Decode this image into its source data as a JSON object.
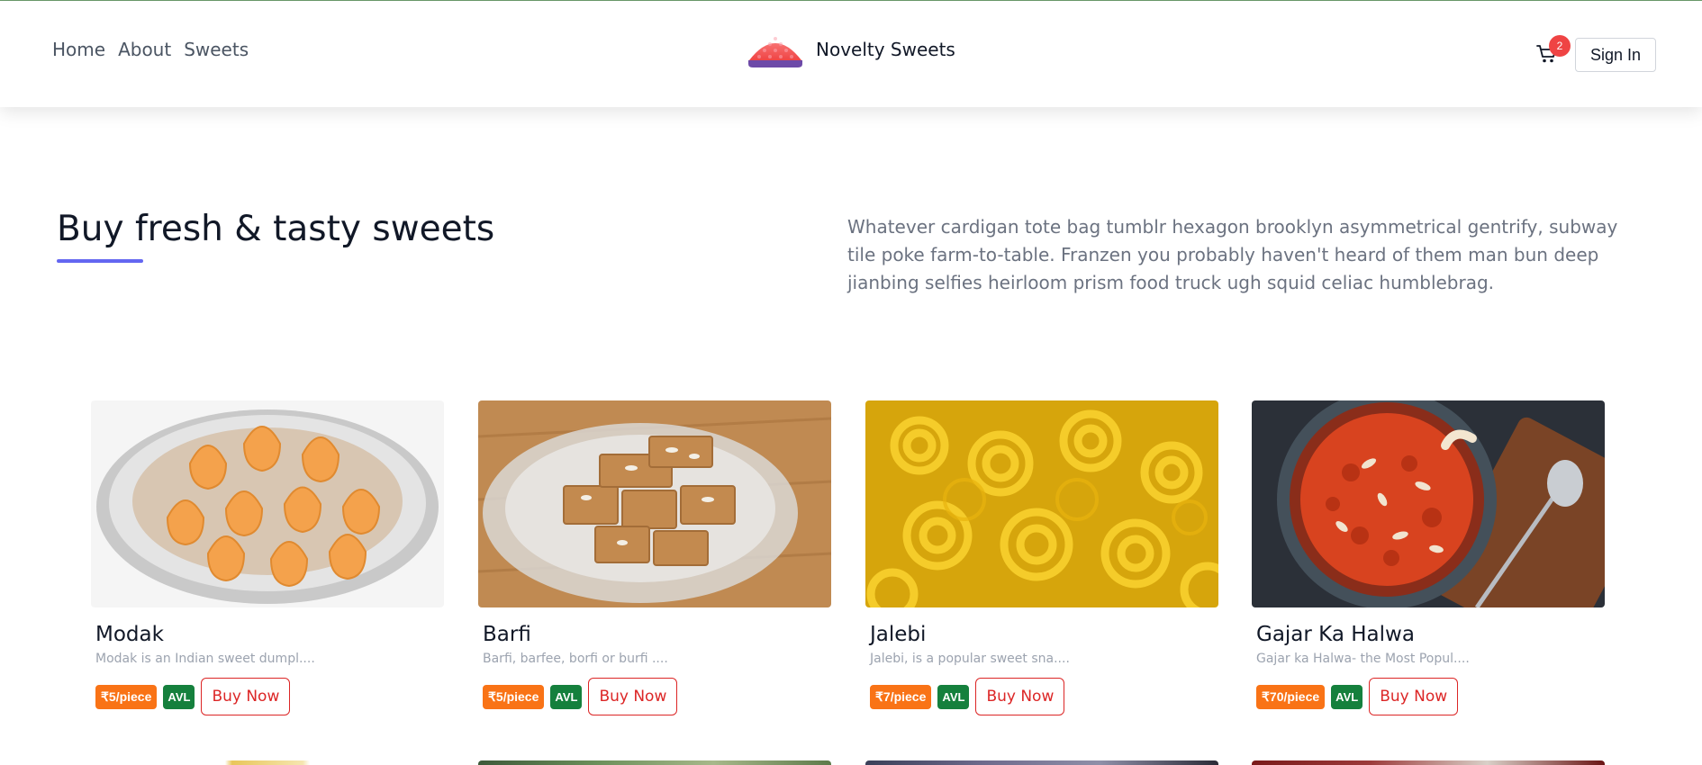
{
  "nav": {
    "links": [
      "Home",
      "About",
      "Sweets"
    ],
    "brand_name": "Novelty Sweets",
    "cart_count": "2",
    "signin_label": "Sign In"
  },
  "hero": {
    "title": "Buy fresh & tasty sweets",
    "text": "Whatever cardigan tote bag tumblr hexagon brooklyn asymmetrical gentrify, subway tile poke farm-to-table. Franzen you probably haven't heard of them man bun deep jianbing selfies heirloom prism food truck ugh squid celiac humblebrag."
  },
  "products": [
    {
      "name": "Modak",
      "desc": "Modak is an Indian sweet dumpl....",
      "price": "₹5/piece",
      "status": "AVL",
      "button": "Buy Now"
    },
    {
      "name": "Barfi",
      "desc": "Barfi, barfee, borfi or burfi ....",
      "price": "₹5/piece",
      "status": "AVL",
      "button": "Buy Now"
    },
    {
      "name": "Jalebi",
      "desc": "Jalebi, is a popular sweet sna....",
      "price": "₹7/piece",
      "status": "AVL",
      "button": "Buy Now"
    },
    {
      "name": "Gajar Ka Halwa",
      "desc": "Gajar ka Halwa- the Most Popul....",
      "price": "₹70/piece",
      "status": "AVL",
      "button": "Buy Now"
    }
  ],
  "colors": {
    "accent": "#6366f1",
    "price_badge": "#f97316",
    "status_badge": "#15803d",
    "buy_button": "#dc2626",
    "cart_badge": "#ef4444"
  },
  "icons": [
    "brand-logo-icon",
    "cart-icon"
  ]
}
